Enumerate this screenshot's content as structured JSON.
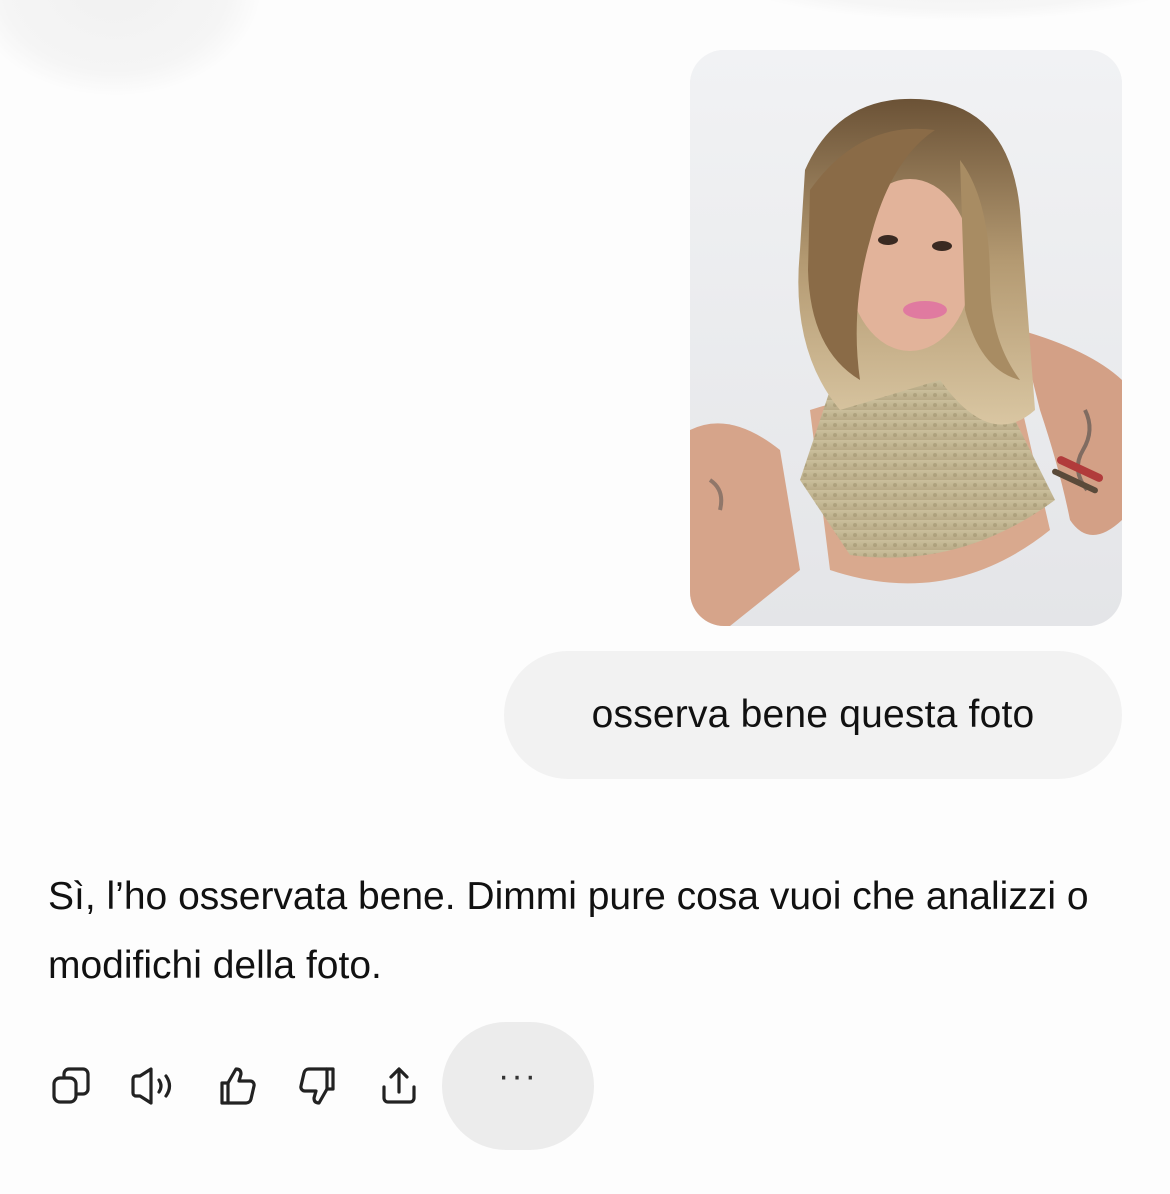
{
  "conversation": {
    "user_image": {
      "icon": "attached-photo"
    },
    "user_message": "osserva bene questa foto",
    "assistant_message": "Sì, l’ho osservata bene. Dimmi pure cosa vuoi che analizzi o modifichi della foto."
  },
  "actions": {
    "copy": {
      "icon": "copy-icon"
    },
    "read_aloud": {
      "icon": "speaker-icon"
    },
    "like": {
      "icon": "thumbs-up-icon"
    },
    "dislike": {
      "icon": "thumbs-down-icon"
    },
    "share": {
      "icon": "share-icon"
    },
    "more": {
      "icon": "more-icon",
      "label": "···"
    }
  }
}
